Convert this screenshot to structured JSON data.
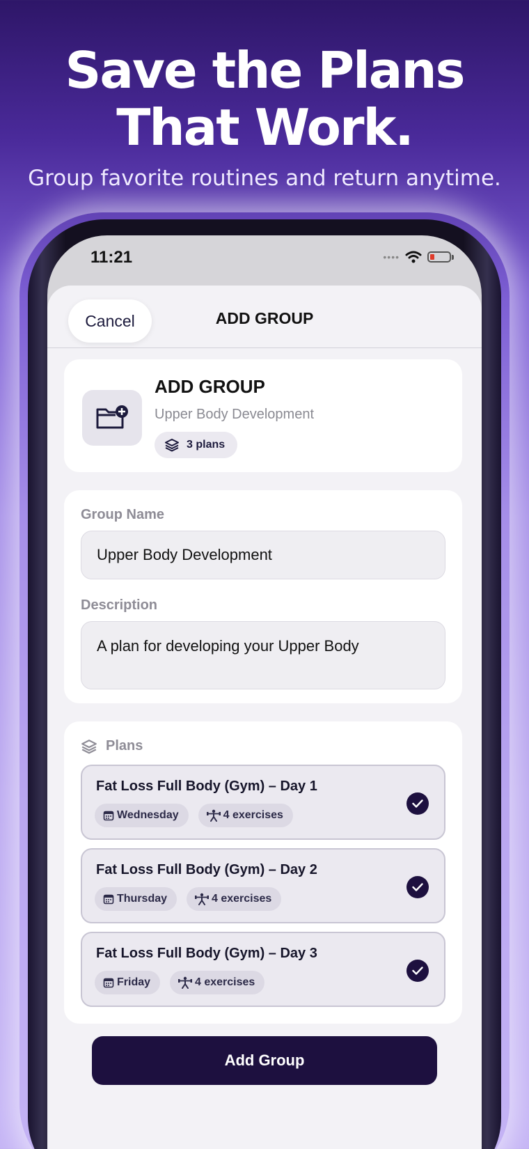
{
  "hero": {
    "headline_line1": "Save the Plans",
    "headline_line2": "That Work.",
    "subline": "Group favorite routines and return anytime."
  },
  "status_bar": {
    "time": "11:21"
  },
  "nav": {
    "cancel_label": "Cancel",
    "title": "ADD GROUP"
  },
  "header_card": {
    "title": "ADD GROUP",
    "subtitle": "Upper Body Development",
    "plans_count": "3 plans"
  },
  "form": {
    "group_name_label": "Group Name",
    "group_name_value": "Upper Body Development",
    "description_label": "Description",
    "description_value": "A plan for developing your Upper Body"
  },
  "plans": {
    "section_label": "Plans",
    "items": [
      {
        "title": "Fat Loss Full Body (Gym) – Day 1",
        "day": "Wednesday",
        "exercises": "4 exercises",
        "selected": true
      },
      {
        "title": "Fat Loss Full Body (Gym) – Day 2",
        "day": "Thursday",
        "exercises": "4 exercises",
        "selected": true
      },
      {
        "title": "Fat Loss Full Body (Gym) – Day 3",
        "day": "Friday",
        "exercises": "4 exercises",
        "selected": true
      }
    ]
  },
  "actions": {
    "add_group_label": "Add Group"
  },
  "colors": {
    "accent": "#1d103f",
    "background_top": "#2e1668",
    "background_bottom": "#c4b3f5"
  },
  "icons": [
    "folder-plus-icon",
    "layers-icon",
    "calendar-icon",
    "weightlifter-icon",
    "checkmark-icon",
    "wifi-icon",
    "battery-icon"
  ]
}
